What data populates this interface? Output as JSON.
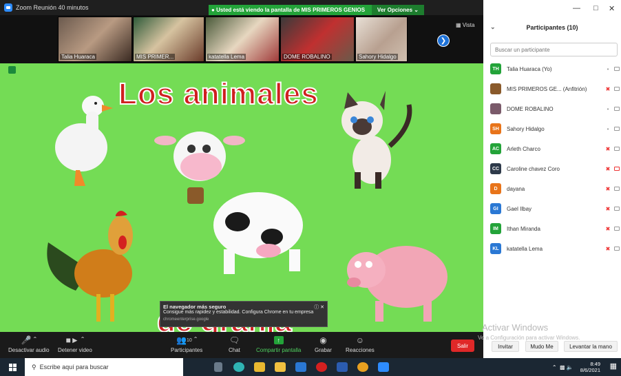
{
  "window": {
    "title": "Zoom Reunión 40 minutos"
  },
  "share_banner": {
    "message": "Usted está viendo la pantalla de MIS PRIMEROS GENIOS",
    "options": "Ver Opciones"
  },
  "thumbnails": [
    {
      "name": "Talia Huaraca"
    },
    {
      "name": "MIS PRIMER..."
    },
    {
      "name": "katatella Lema"
    },
    {
      "name": "DOME ROBALINO"
    },
    {
      "name": "Sahory Hidalgo"
    }
  ],
  "view_label": "Vista",
  "slide": {
    "title": "Los animales",
    "subtitle": "de granja"
  },
  "toast": {
    "title": "El navegador más seguro",
    "body": "Consigue más rapidez y estabilidad. Configura Chrome en tu empresa",
    "source": "chromeenterprise.google"
  },
  "toolbar": {
    "audio": "Desactivar audio",
    "video": "Detener video",
    "participants": "Participantes",
    "participants_count": "10",
    "chat": "Chat",
    "share": "Compartir pantalla",
    "record": "Grabar",
    "reactions": "Reacciones",
    "leave": "Salir"
  },
  "panel": {
    "title": "Participantes (10)",
    "search_placeholder": "Buscar un participante",
    "invite": "Invitar",
    "mute_me": "Mudo Me",
    "raise_hand": "Levantar la mano",
    "participants": [
      {
        "initials": "TH",
        "name": "Talia Huaraca (Yo)",
        "color": "#23a339",
        "mic_off": false,
        "cam_off": false
      },
      {
        "initials": "",
        "name": "MIS PRIMEROS GE... (Anfitrión)",
        "color": "#8a5a2b",
        "mic_off": true,
        "cam_off": false
      },
      {
        "initials": "",
        "name": "DOME ROBALINO",
        "color": "#7a5a6a",
        "mic_off": false,
        "cam_off": false
      },
      {
        "initials": "SH",
        "name": "Sahory Hidalgo",
        "color": "#e8741a",
        "mic_off": false,
        "cam_off": false
      },
      {
        "initials": "AC",
        "name": "Arleth Charco",
        "color": "#23a339",
        "mic_off": true,
        "cam_off": false
      },
      {
        "initials": "CC",
        "name": "Caroline  chavez  Coro",
        "color": "#2e3a4a",
        "mic_off": true,
        "cam_off": true
      },
      {
        "initials": "D",
        "name": "dayana",
        "color": "#e8741a",
        "mic_off": true,
        "cam_off": false
      },
      {
        "initials": "GI",
        "name": "Gael Ilbay",
        "color": "#2a78d4",
        "mic_off": true,
        "cam_off": false
      },
      {
        "initials": "IM",
        "name": "Ithan Miranda",
        "color": "#23a339",
        "mic_off": true,
        "cam_off": false
      },
      {
        "initials": "KL",
        "name": "katatella Lema",
        "color": "#2a78d4",
        "mic_off": true,
        "cam_off": false
      }
    ]
  },
  "watermark": {
    "line1": "Activar Windows",
    "line2": "Ve a Configuración para activar Windows."
  },
  "taskbar": {
    "search": "Escribe aquí para buscar",
    "time": "8:49",
    "date": "8/6/2021"
  }
}
